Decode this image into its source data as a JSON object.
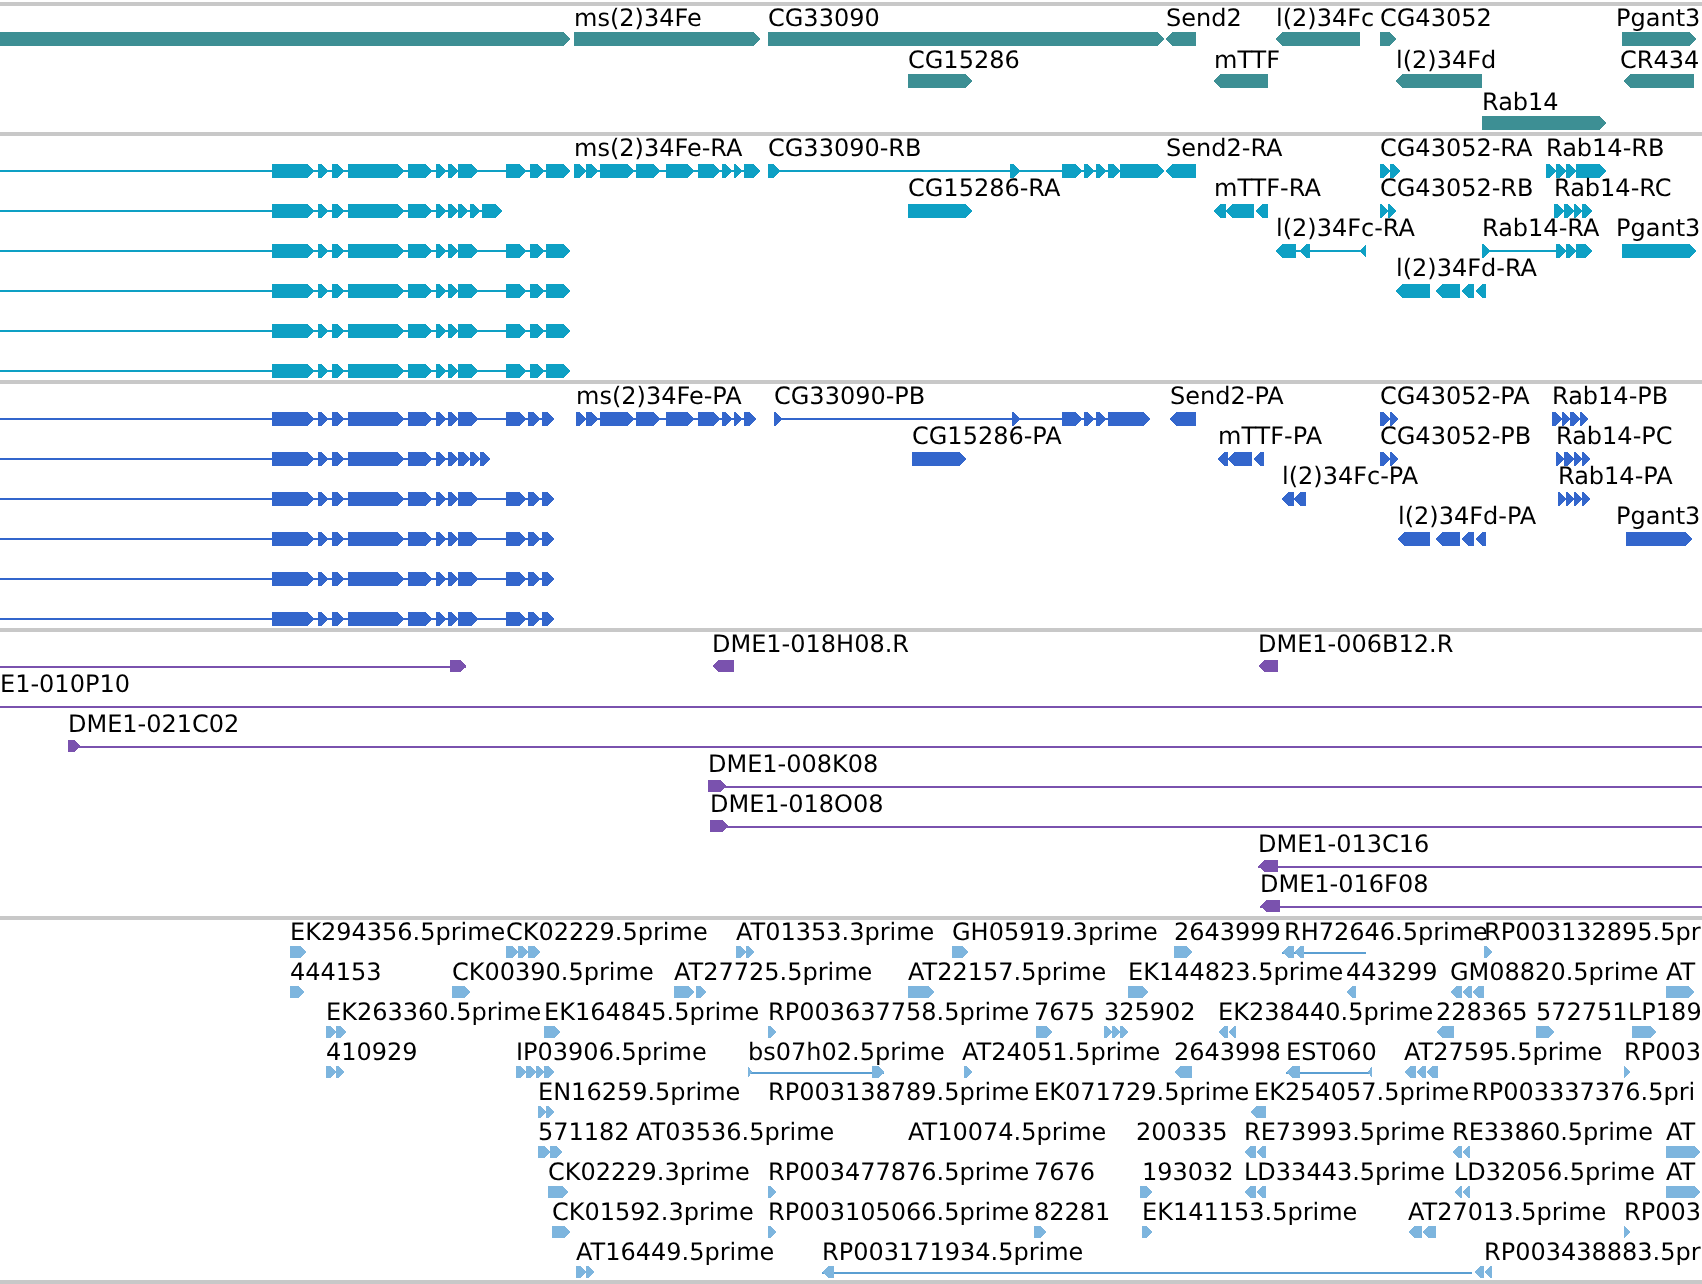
{
  "tracks": [
    {
      "kind": "gene",
      "features": [
        {
          "reverse": false
        },
        {
          "label": "ms(2)34Fe",
          "reverse": false
        },
        {
          "label": "CG33090",
          "reverse": false
        },
        {
          "label": "Send2",
          "reverse": true
        },
        {
          "label": "l(2)34Fc",
          "reverse": true
        },
        {
          "label": "CG43052",
          "reverse": false
        },
        {
          "label": "Pgant3",
          "reverse": false
        },
        {
          "label": "CG15286",
          "reverse": false
        },
        {
          "label": "mTTF",
          "reverse": true
        },
        {
          "label": "l(2)34Fd",
          "reverse": true
        },
        {
          "label": "CR434",
          "reverse": true
        },
        {
          "label": "Rab14",
          "reverse": false
        }
      ]
    },
    {
      "kind": "transcript",
      "features": [
        {
          "reverse": false
        },
        {
          "label": "ms(2)34Fe-RA",
          "reverse": false
        },
        {
          "label": "CG33090-RB",
          "reverse": false
        },
        {
          "label": "Send2-RA",
          "reverse": true
        },
        {
          "label": "CG43052-RA",
          "reverse": false
        },
        {
          "label": "Rab14-RB",
          "reverse": false
        },
        {
          "reverse": false
        },
        {
          "label": "CG15286-RA",
          "reverse": false
        },
        {
          "label": "mTTF-RA",
          "reverse": true
        },
        {
          "label": "CG43052-RB",
          "reverse": false
        },
        {
          "label": "Rab14-RC",
          "reverse": false
        },
        {
          "reverse": false
        },
        {
          "label": "l(2)34Fc-RA",
          "reverse": true
        },
        {
          "label": "Rab14-RA",
          "reverse": false
        },
        {
          "label": "Pgant3",
          "reverse": false
        },
        {
          "reverse": false
        },
        {
          "label": "l(2)34Fd-RA",
          "reverse": true
        },
        {
          "reverse": false
        },
        {
          "reverse": false
        }
      ]
    },
    {
      "kind": "polypeptide",
      "features": [
        {
          "reverse": false
        },
        {
          "label": "ms(2)34Fe-PA",
          "reverse": false
        },
        {
          "label": "CG33090-PB",
          "reverse": false
        },
        {
          "label": "Send2-PA",
          "reverse": true
        },
        {
          "label": "CG43052-PA",
          "reverse": false
        },
        {
          "label": "Rab14-PB",
          "reverse": false
        },
        {
          "reverse": false
        },
        {
          "label": "CG15286-PA",
          "reverse": false
        },
        {
          "label": "mTTF-PA",
          "reverse": true
        },
        {
          "label": "CG43052-PB",
          "reverse": false
        },
        {
          "label": "Rab14-PC",
          "reverse": false
        },
        {
          "reverse": false
        },
        {
          "label": "l(2)34Fc-PA",
          "reverse": true
        },
        {
          "label": "Rab14-PA",
          "reverse": false
        },
        {
          "reverse": false
        },
        {
          "label": "l(2)34Fd-PA",
          "reverse": true
        },
        {
          "label": "Pgant3",
          "reverse": false
        },
        {
          "reverse": false
        },
        {
          "reverse": false
        }
      ]
    },
    {
      "kind": "clone",
      "features": [
        {
          "reverse": false
        },
        {
          "label": "DME1-018H08.R",
          "reverse": true
        },
        {
          "label": "DME1-006B12.R",
          "reverse": true
        },
        {
          "label": "E1-010P10"
        },
        {
          "label": "DME1-021C02",
          "reverse": false
        },
        {
          "label": "DME1-008K08",
          "reverse": false
        },
        {
          "label": "DME1-018O08",
          "reverse": false
        },
        {
          "label": "DME1-013C16",
          "reverse": true
        },
        {
          "label": "DME1-016F08",
          "reverse": true
        }
      ]
    },
    {
      "kind": "est",
      "features": [
        {
          "label": "EK294356.5prime",
          "reverse": false
        },
        {
          "label": "CK02229.5prime",
          "reverse": false
        },
        {
          "label": "AT01353.3prime",
          "reverse": false
        },
        {
          "label": "GH05919.3prime",
          "reverse": false
        },
        {
          "label": "2643999",
          "reverse": false
        },
        {
          "label": "RH72646.5prime",
          "reverse": true
        },
        {
          "label": "RP003132895.5pr",
          "reverse": false
        },
        {
          "label": "444153",
          "reverse": false
        },
        {
          "label": "CK00390.5prime",
          "reverse": false
        },
        {
          "label": "AT27725.5prime",
          "reverse": false
        },
        {
          "label": "AT22157.5prime",
          "reverse": false
        },
        {
          "label": "EK144823.5prime",
          "reverse": false
        },
        {
          "label": "443299",
          "reverse": true
        },
        {
          "label": "GM08820.5prime",
          "reverse": true
        },
        {
          "label": "AT",
          "reverse": false
        },
        {
          "label": "EK263360.5prime",
          "reverse": false
        },
        {
          "label": "EK164845.5prime",
          "reverse": false
        },
        {
          "label": "RP003637758.5prime",
          "reverse": false
        },
        {
          "label": "7675",
          "reverse": false
        },
        {
          "label": "325902",
          "reverse": false
        },
        {
          "label": "EK238440.5prime",
          "reverse": true
        },
        {
          "label": "228365",
          "reverse": true
        },
        {
          "label": "572751",
          "reverse": false
        },
        {
          "label": "LP189",
          "reverse": false
        },
        {
          "label": "410929",
          "reverse": false
        },
        {
          "label": "IP03906.5prime",
          "reverse": false
        },
        {
          "label": "bs07h02.5prime",
          "reverse": false
        },
        {
          "label": "AT24051.5prime",
          "reverse": false
        },
        {
          "label": "2643998",
          "reverse": true
        },
        {
          "label": "EST060",
          "reverse": true
        },
        {
          "label": "AT27595.5prime",
          "reverse": true
        },
        {
          "label": "RP003",
          "reverse": false
        },
        {
          "label": "EN16259.5prime",
          "reverse": false
        },
        {
          "label": "RP003138789.5prime"
        },
        {
          "label": "EK071729.5prime"
        },
        {
          "label": "EK254057.5prime",
          "reverse": true
        },
        {
          "label": "RP003337376.5pri"
        },
        {
          "label": "571182",
          "reverse": false
        },
        {
          "label": "AT03536.5prime"
        },
        {
          "label": "AT10074.5prime"
        },
        {
          "label": "200335"
        },
        {
          "label": "RE73993.5prime",
          "reverse": true
        },
        {
          "label": "RE33860.5prime",
          "reverse": true
        },
        {
          "label": "AT",
          "reverse": false
        },
        {
          "label": "CK02229.3prime",
          "reverse": false
        },
        {
          "label": "RP003477876.5prime",
          "reverse": false
        },
        {
          "label": "7676"
        },
        {
          "label": "193032",
          "reverse": false
        },
        {
          "label": "LD33443.5prime",
          "reverse": true
        },
        {
          "label": "LD32056.5prime",
          "reverse": true
        },
        {
          "label": "AT",
          "reverse": false
        },
        {
          "label": "CK01592.3prime",
          "reverse": false
        },
        {
          "label": "RP003105066.5prime",
          "reverse": false
        },
        {
          "label": "82281",
          "reverse": false
        },
        {
          "label": "EK141153.5prime",
          "reverse": false
        },
        {
          "label": "AT27013.5prime",
          "reverse": true
        },
        {
          "label": "RP003",
          "reverse": false
        },
        {
          "label": "AT16449.5prime",
          "reverse": false
        },
        {
          "label": "RP003171934.5prime",
          "reverse": true
        },
        {
          "label": "RP003438883.5pr",
          "reverse": true
        }
      ]
    }
  ]
}
